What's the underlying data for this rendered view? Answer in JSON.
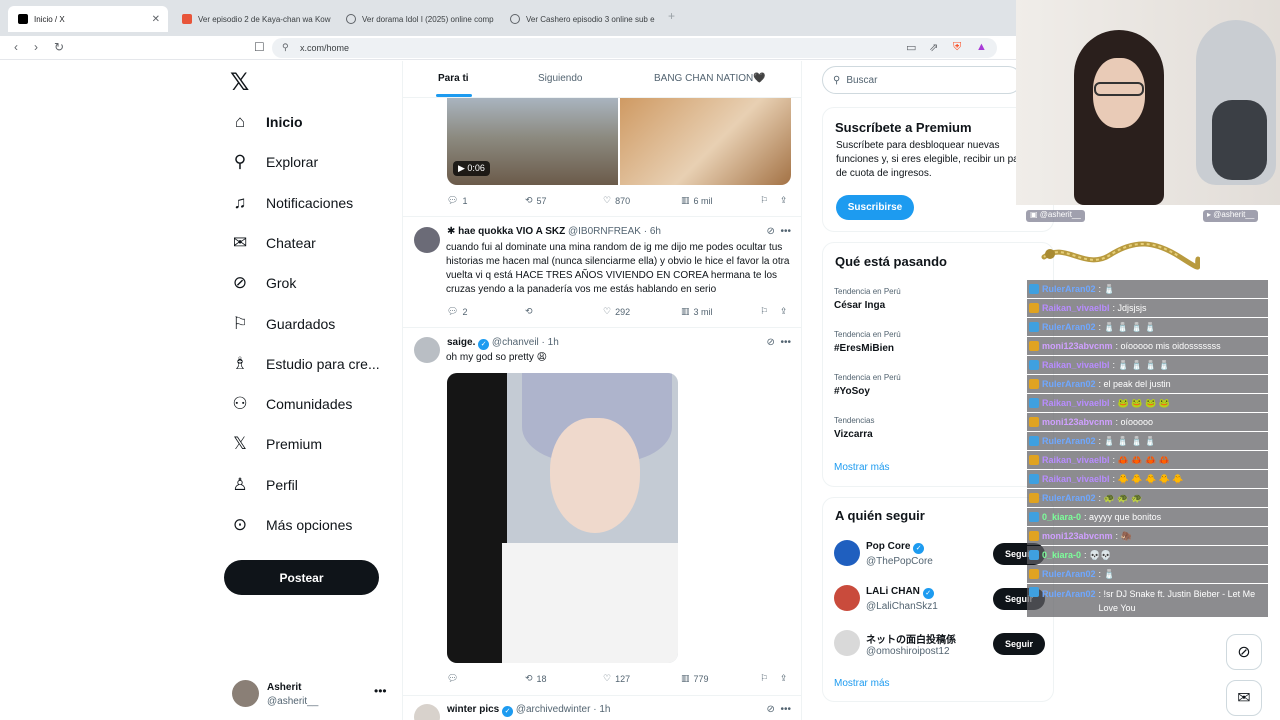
{
  "browser": {
    "tabs": [
      {
        "title": "Inicio / X",
        "color": "#000000"
      },
      {
        "title": "Ver episodio 2 de Kaya-chan wa Kow",
        "color": "#e8553a"
      },
      {
        "title": "Ver dorama Idol I (2025) online comp",
        "color": "#5f6368"
      },
      {
        "title": "Ver Cashero episodio 3 online sub e",
        "color": "#5f6368"
      }
    ],
    "url": "x.com/home"
  },
  "nav": {
    "items": [
      {
        "label": "Inicio",
        "icon": "home-icon"
      },
      {
        "label": "Explorar",
        "icon": "search-icon"
      },
      {
        "label": "Notificaciones",
        "icon": "bell-icon"
      },
      {
        "label": "Chatear",
        "icon": "mail-icon"
      },
      {
        "label": "Grok",
        "icon": "grok-icon"
      },
      {
        "label": "Guardados",
        "icon": "bookmark-icon"
      },
      {
        "label": "Estudio para cre...",
        "icon": "creator-studio-icon"
      },
      {
        "label": "Comunidades",
        "icon": "communities-icon"
      },
      {
        "label": "Premium",
        "icon": "x-premium-icon"
      },
      {
        "label": "Perfil",
        "icon": "profile-icon"
      },
      {
        "label": "Más opciones",
        "icon": "more-options-icon"
      }
    ],
    "post_label": "Postear",
    "account": {
      "name": "Asherit",
      "handle": "@asherit__"
    }
  },
  "timeline": {
    "tabs": [
      "Para ti",
      "Siguiendo",
      "BANG CHAN NATION🖤"
    ],
    "tweet1": {
      "duration": "0:06",
      "replies": "1",
      "reposts": "57",
      "likes": "870",
      "views": "6 mil"
    },
    "tweet2": {
      "name": "✱ hae quokka VIO A SKZ",
      "handle": "@IB0RNFREAK",
      "time": "· 6h",
      "text": "cuando fui al dominate una mina random de ig me dijo me podes ocultar tus historias me hacen mal (nunca silenciarme ella) y obvio le hice el favor la otra vuelta vi q está HACE TRES AÑOS VIVIENDO EN COREA hermana te los cruzas yendo a la panadería vos me estás hablando en serio",
      "replies": "2",
      "reposts": "",
      "likes": "292",
      "views": "3 mil"
    },
    "tweet3": {
      "name": "saige.",
      "handle": "@chanveil",
      "time": "· 1h",
      "text": "oh my god so pretty 😩",
      "replies": "",
      "reposts": "18",
      "likes": "127",
      "views": "779"
    },
    "tweet4": {
      "name": "winter pics",
      "handle": "@archivedwinter",
      "time": "· 1h"
    }
  },
  "sidebar": {
    "search_placeholder": "Buscar",
    "premium": {
      "title": "Suscríbete a Premium",
      "text": "Suscríbete para desbloquear nuevas funciones y, si eres elegible, recibir un pago de cuota de ingresos.",
      "button": "Suscribirse"
    },
    "trends": {
      "title": "Qué está pasando",
      "items": [
        {
          "context": "Tendencia en Perú",
          "name": "César Inga"
        },
        {
          "context": "Tendencia en Perú",
          "name": "#EresMiBien"
        },
        {
          "context": "Tendencia en Perú",
          "name": "#YoSoy"
        },
        {
          "context": "Tendencias",
          "name": "Vizcarra"
        }
      ],
      "more": "Mostrar más"
    },
    "follow": {
      "title": "A quién seguir",
      "items": [
        {
          "name": "Pop Core",
          "handle": "@ThePopCore",
          "button": "Seguir",
          "color": "#1f5fbf"
        },
        {
          "name": "LALi CHAN",
          "handle": "@LaliChanSkz1",
          "button": "Seguir",
          "color": "#c94b3c"
        },
        {
          "name": "ネットの面白投稿係",
          "handle": "@omoshiroipost12",
          "button": "Seguir",
          "color": "#d9d9d9"
        }
      ],
      "more": "Mostrar más"
    }
  },
  "stream": {
    "cam_tags": [
      "@asherit__",
      "@asherit__"
    ],
    "chat": [
      {
        "user": "RulerAran02",
        "msg": " : 🧂",
        "color": "#6fa8ff"
      },
      {
        "user": "Raikan_vivaelbl",
        "msg": " : Jdjsjsjs",
        "color": "#b88cff"
      },
      {
        "user": "RulerAran02",
        "msg": " : 🧂 🧂 🧂 🧂",
        "color": "#6fa8ff"
      },
      {
        "user": "moni123abvcnm",
        "msg": " : oíooooo mis oidosssssss",
        "color": "#d0a0ff"
      },
      {
        "user": "Raikan_vivaelbl",
        "msg": " : 🧂 🧂 🧂 🧂",
        "color": "#b88cff"
      },
      {
        "user": "RulerAran02",
        "msg": " : el peak del justin",
        "color": "#6fa8ff"
      },
      {
        "user": "Raikan_vivaelbl",
        "msg": " : 🐸 🐸 🐸 🐸",
        "color": "#b88cff"
      },
      {
        "user": "moni123abvcnm",
        "msg": " : oíooooo",
        "color": "#d0a0ff"
      },
      {
        "user": "RulerAran02",
        "msg": " : 🧂 🧂 🧂 🧂",
        "color": "#6fa8ff"
      },
      {
        "user": "Raikan_vivaelbl",
        "msg": " : 🦀 🦀 🦀 🦀",
        "color": "#b88cff"
      },
      {
        "user": "Raikan_vivaelbl",
        "msg": " : 🐥 🐥 🐥 🐥 🐥",
        "color": "#b88cff"
      },
      {
        "user": "RulerAran02",
        "msg": " : 🐢 🐢 🐢",
        "color": "#6fa8ff"
      },
      {
        "user": "0_kiara-0",
        "msg": " : ayyyy que bonitos",
        "color": "#7cff9a"
      },
      {
        "user": "moni123abvcnm",
        "msg": " : 🦣",
        "color": "#d0a0ff"
      },
      {
        "user": "0_kiara-0",
        "msg": " : 💀💀",
        "color": "#7cff9a"
      },
      {
        "user": "RulerAran02",
        "msg": " : 🧂",
        "color": "#6fa8ff"
      },
      {
        "user": "RulerAran02",
        "msg": " : !sr DJ Snake ft. Justin Bieber - Let Me Love You",
        "color": "#6fa8ff"
      }
    ]
  }
}
